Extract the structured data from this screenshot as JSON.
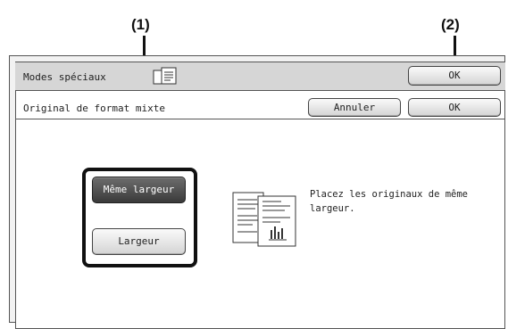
{
  "callouts": {
    "one": "(1)",
    "two": "(2)"
  },
  "header": {
    "title": "Modes spéciaux",
    "ok_label": "OK",
    "icon": "document-icon"
  },
  "subheader": {
    "title": "Original de format mixte",
    "cancel_label": "Annuler",
    "ok_label": "OK"
  },
  "options": {
    "same_width": "Même largeur",
    "width": "Largeur",
    "selected": "Même largeur"
  },
  "message": "Placez les originaux de même largeur.",
  "colors": {
    "selected_button": "#4a4a4a",
    "callout_outline": "#111111"
  }
}
